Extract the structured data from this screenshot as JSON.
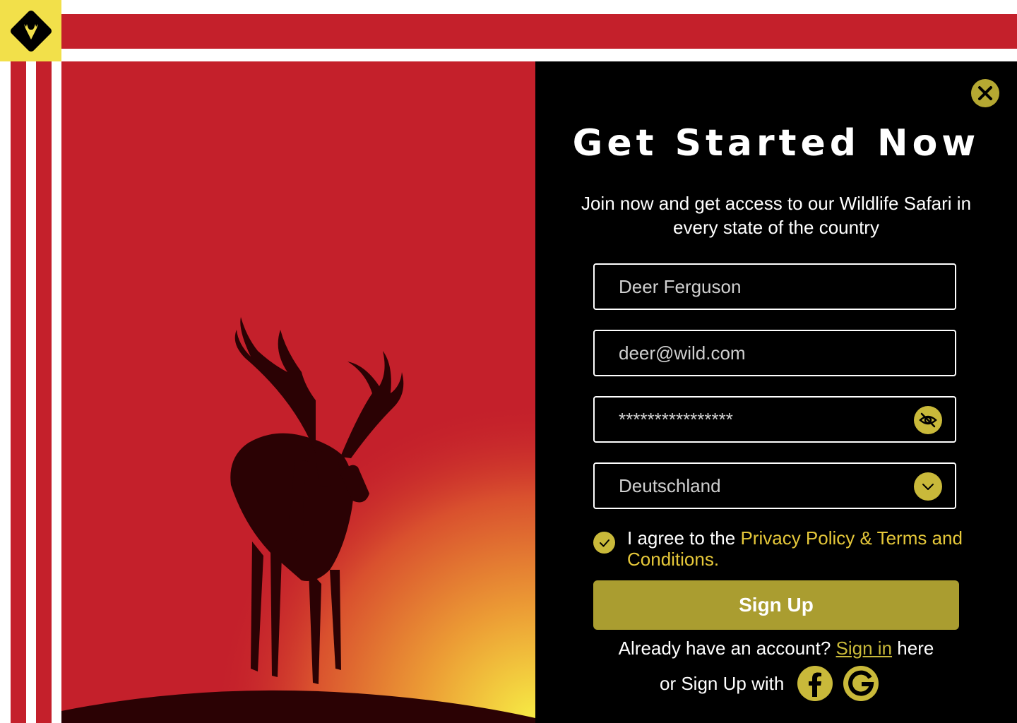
{
  "brand": {
    "logo_icon": "deer-head-icon",
    "colors": {
      "red": "#c4202b",
      "yellow": "#f2e04a",
      "gold": "#c9b93a",
      "black": "#000000"
    }
  },
  "panel": {
    "close_icon": "close-icon",
    "title": "Get Started Now",
    "subtitle": "Join now and get access to our Wildlife Safari in every state of the country"
  },
  "form": {
    "name_value": "Deer Ferguson",
    "email_value": "deer@wild.com",
    "password_value": "****************",
    "password_toggle_icon": "eye-off-icon",
    "country_value": "Deutschland",
    "country_icon": "chevron-down-icon",
    "agree_prefix": "I agree to the ",
    "agree_link": "Privacy Policy & Terms and Conditions.",
    "agree_checked": true,
    "signup_label": "Sign Up"
  },
  "footer": {
    "signin_prefix": "Already have an account? ",
    "signin_link": "Sign in",
    "signin_suffix": " here",
    "social_label": "or Sign Up with",
    "facebook_icon": "facebook-icon",
    "google_icon": "google-icon"
  }
}
